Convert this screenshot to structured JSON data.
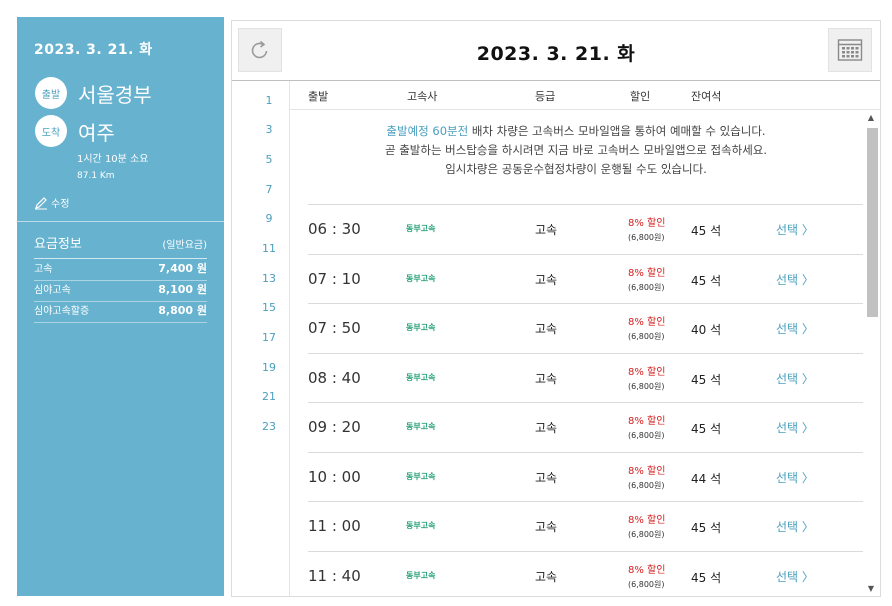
{
  "summary": {
    "date": "2023. 3. 21. 화",
    "depart_badge": "출발",
    "depart_name": "서울경부",
    "arrive_badge": "도착",
    "arrive_name": "여주",
    "duration": "1시간 10분 소요",
    "distance": "87.1 Km",
    "edit_label": "수정",
    "fare_title": "요금정보",
    "fare_sub": "(일반요금)",
    "fares": [
      {
        "label": "고속",
        "price": "7,400 원"
      },
      {
        "label": "심야고속",
        "price": "8,100 원"
      },
      {
        "label": "심야고속할증",
        "price": "8,800 원"
      }
    ]
  },
  "header": {
    "date": "2023. 3. 21. 화",
    "refresh_icon": "refresh-icon",
    "calendar_icon": "calendar-icon"
  },
  "hours": [
    "1",
    "3",
    "5",
    "7",
    "9",
    "11",
    "13",
    "15",
    "17",
    "19",
    "21",
    "23"
  ],
  "columns": {
    "depart": "출발",
    "company": "고속사",
    "grade": "등급",
    "discount": "할인",
    "seats": "잔여석"
  },
  "notice": {
    "highlight": "출발예정 60분전",
    "line1_rest": " 배차 차량은 고속버스 모바일앱을 통하여 예매할 수 있습니다.",
    "line2": "곧 출발하는 버스탑승을 하시려면 지금 바로 고속버스 모바일앱으로 접속하세요.",
    "line3": "임시차량은 공동운수협정차량이 운행될 수도 있습니다."
  },
  "schedule": [
    {
      "time": "06 : 30",
      "company": "동부고속",
      "grade": "고속",
      "discount": "8% 할인",
      "price": "(6,800원)",
      "seats": "45 석",
      "select": "선택 〉"
    },
    {
      "time": "07 : 10",
      "company": "동부고속",
      "grade": "고속",
      "discount": "8% 할인",
      "price": "(6,800원)",
      "seats": "45 석",
      "select": "선택 〉"
    },
    {
      "time": "07 : 50",
      "company": "동부고속",
      "grade": "고속",
      "discount": "8% 할인",
      "price": "(6,800원)",
      "seats": "40 석",
      "select": "선택 〉"
    },
    {
      "time": "08 : 40",
      "company": "동부고속",
      "grade": "고속",
      "discount": "8% 할인",
      "price": "(6,800원)",
      "seats": "45 석",
      "select": "선택 〉"
    },
    {
      "time": "09 : 20",
      "company": "동부고속",
      "grade": "고속",
      "discount": "8% 할인",
      "price": "(6,800원)",
      "seats": "45 석",
      "select": "선택 〉"
    },
    {
      "time": "10 : 00",
      "company": "동부고속",
      "grade": "고속",
      "discount": "8% 할인",
      "price": "(6,800원)",
      "seats": "44 석",
      "select": "선택 〉"
    },
    {
      "time": "11 : 00",
      "company": "동부고속",
      "grade": "고속",
      "discount": "8% 할인",
      "price": "(6,800원)",
      "seats": "45 석",
      "select": "선택 〉"
    },
    {
      "time": "11 : 40",
      "company": "동부고속",
      "grade": "고속",
      "discount": "8% 할인",
      "price": "(6,800원)",
      "seats": "45 석",
      "select": "선택 〉"
    }
  ],
  "colors": {
    "panel": "#66b2cf",
    "accent": "#4a9fbf",
    "company": "#2aa27a",
    "discount": "#d42020"
  }
}
